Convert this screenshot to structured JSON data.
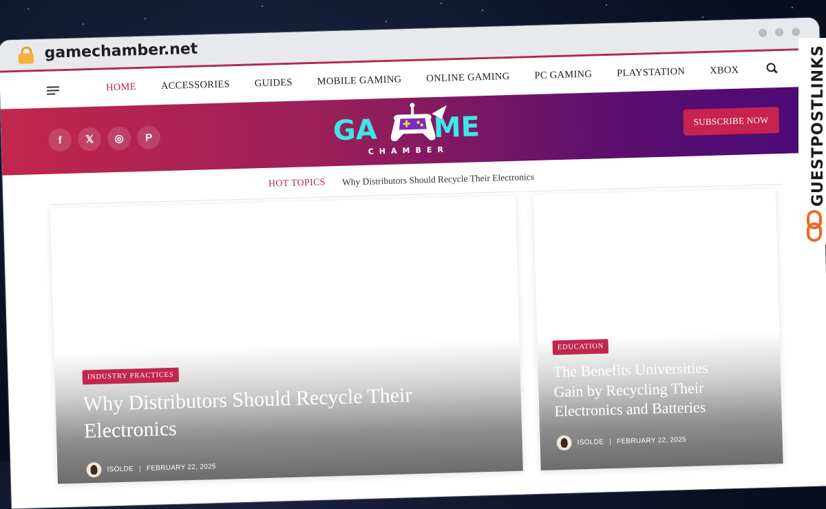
{
  "browser": {
    "url": "gamechamber.net"
  },
  "nav": {
    "items": [
      {
        "label": "HOME",
        "active": true
      },
      {
        "label": "ACCESSORIES"
      },
      {
        "label": "GUIDES"
      },
      {
        "label": "MOBILE GAMING"
      },
      {
        "label": "ONLINE GAMING"
      },
      {
        "label": "PC GAMING"
      },
      {
        "label": "PLAYSTATION"
      },
      {
        "label": "XBOX"
      }
    ]
  },
  "banner": {
    "logo_top": "GA ME",
    "logo_bottom": "CHAMBER",
    "subscribe_label": "SUBSCRIBE NOW",
    "social": [
      "f",
      "𝕏",
      "◎",
      "P"
    ]
  },
  "hot_topics": {
    "label": "HOT TOPICS",
    "title": "Why Distributors Should Recycle Their Electronics"
  },
  "featured": {
    "tag": "INDUSTRY PRACTICES",
    "title": "Why Distributors Should Recycle Their Electronics",
    "author": "ISOLDE",
    "date": "FEBRUARY 22, 2025"
  },
  "side_post": {
    "tag": "EDUCATION",
    "title": "The Benefits Universities Gain by Recycling Their Electronics and Batteries",
    "author": "ISOLDE",
    "date": "FEBRUARY 22, 2025"
  },
  "watermark": {
    "text": "GUESTPOSTLINKS"
  },
  "colors": {
    "accent": "#c2264d",
    "banner_start": "#c2264d",
    "banner_end": "#4a0a78",
    "logo_cyan": "#3fe6e6"
  }
}
